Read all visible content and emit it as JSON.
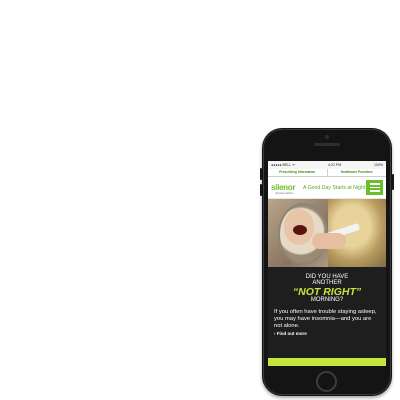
{
  "status_bar": {
    "carrier": "●●●●● BELL ᯤ",
    "time": "4:21 PM",
    "battery": "100%"
  },
  "top_links": [
    "Prescribing Information",
    "Healthcare Providers"
  ],
  "header": {
    "logo": "silenor",
    "logo_sub": "(doxepin) tablets",
    "tagline": "A Good Day Starts at Night"
  },
  "promo": {
    "line1": "DID YOU HAVE",
    "line2": "ANOTHER",
    "line3": "“NOT RIGHT”",
    "line4": "MORNING?",
    "body": "If you often have trouble staying asleep, you may have insomnia—and you are not alone.",
    "link": "› Find out more"
  },
  "colors": {
    "accent_green": "#6bbf2a",
    "lime": "#c4e53b",
    "phone_body": "#141414"
  }
}
